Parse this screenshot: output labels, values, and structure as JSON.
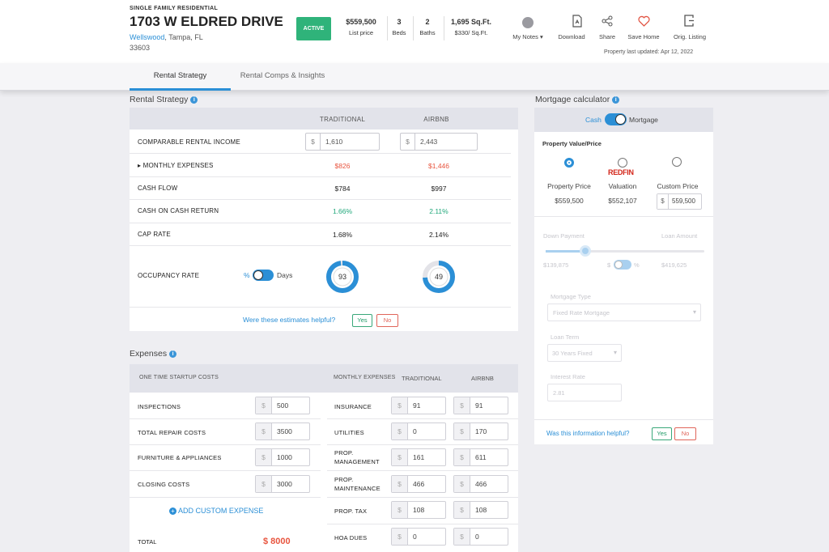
{
  "header": {
    "property_type": "SINGLE FAMILY RESIDENTIAL",
    "address": "1703 W ELDRED DRIVE",
    "neighborhood": "Wellswood",
    "city_state": ", Tampa, FL",
    "zip": "33603",
    "status": "ACTIVE",
    "list_price": "$559,500",
    "list_price_label": "List price",
    "beds": "3",
    "beds_label": "Beds",
    "baths": "2",
    "baths_label": "Baths",
    "sqft": "1,695 Sq.Ft.",
    "price_per_sqft": "$330/ Sq.Ft.",
    "actions": {
      "notes": "My Notes",
      "download": "Download",
      "share": "Share",
      "save": "Save Home",
      "listing": "Orig. Listing"
    },
    "last_updated": "Property last updated: Apr 12, 2022"
  },
  "tabs": {
    "rental_strategy": "Rental Strategy",
    "rental_comps": "Rental Comps & Insights"
  },
  "rental": {
    "title": "Rental Strategy",
    "col_traditional": "TRADITIONAL",
    "col_airbnb": "AIRBNB",
    "currency": "$",
    "rows": {
      "income": {
        "label": "COMPARABLE RENTAL INCOME",
        "trad": "1,610",
        "airbnb": "2,443"
      },
      "expenses": {
        "label": "MONTHLY EXPENSES",
        "trad": "$826",
        "airbnb": "$1,446"
      },
      "cashflow": {
        "label": "CASH FLOW",
        "trad": "$784",
        "airbnb": "$997"
      },
      "coc": {
        "label": "CASH ON CASH RETURN",
        "trad": "1.66%",
        "airbnb": "2.11%"
      },
      "cap": {
        "label": "CAP RATE",
        "trad": "1.68%",
        "airbnb": "2.14%"
      }
    },
    "occupancy": {
      "label": "OCCUPANCY RATE",
      "toggle_left": "%",
      "toggle_right": "Days",
      "trad_days": "93",
      "airbnb_days": "49",
      "trad_fraction": 0.98,
      "airbnb_fraction": 0.74
    },
    "helpful_q": "Were these estimates helpful?",
    "yes": "Yes",
    "no": "No"
  },
  "expenses": {
    "title": "Expenses",
    "startup_header": "ONE TIME STARTUP COSTS",
    "monthly_header": "MONTHLY EXPENSES",
    "col_traditional": "TRADITIONAL",
    "col_airbnb": "AIRBNB",
    "currency": "$",
    "startup": [
      {
        "label": "INSPECTIONS",
        "value": "500"
      },
      {
        "label": "TOTAL REPAIR COSTS",
        "value": "3500"
      },
      {
        "label": "FURNITURE & APPLIANCES",
        "value": "1000"
      },
      {
        "label": "CLOSING COSTS",
        "value": "3000"
      }
    ],
    "add_custom": "ADD CUSTOM EXPENSE",
    "total_label": "TOTAL",
    "total_value": "$ 8000",
    "monthly": [
      {
        "label": "INSURANCE",
        "trad": "91",
        "airbnb": "91"
      },
      {
        "label": "UTILITIES",
        "trad": "0",
        "airbnb": "170"
      },
      {
        "label": "PROP. MANAGEMENT",
        "trad": "161",
        "airbnb": "611"
      },
      {
        "label": "PROP. MAINTENANCE",
        "trad": "466",
        "airbnb": "466"
      },
      {
        "label": "PROP. TAX",
        "trad": "108",
        "airbnb": "108"
      },
      {
        "label": "HOA DUES",
        "trad": "0",
        "airbnb": "0"
      }
    ]
  },
  "mortgage": {
    "title": "Mortgage calculator",
    "cash": "Cash",
    "mortgage": "Mortgage",
    "value_title": "Property Value/Price",
    "options": [
      {
        "label": "Property Price",
        "value": "$559,500"
      },
      {
        "brand": "REDFIN",
        "label": "Valuation",
        "value": "$552,107"
      },
      {
        "label": "Custom Price",
        "value": "559,500"
      }
    ],
    "currency": "$",
    "down_payment": "Down Payment",
    "loan_amount": "Loan Amount",
    "down_value": "$139,875",
    "loan_value": "$419,625",
    "toggle_left": "$",
    "toggle_right": "%",
    "mortgage_type_label": "Mortgage Type",
    "mortgage_type": "Fixed Rate Mortgage",
    "loan_term_label": "Loan Term",
    "loan_term": "30 Years Fixed",
    "interest_label": "Interest Rate",
    "interest": "2.81",
    "helpful_q": "Was this information helpful?",
    "yes": "Yes",
    "no": "No"
  },
  "colors": {
    "accent": "#2b8fd6",
    "active_badge": "#2fb37a",
    "expense_red": "#e8553f",
    "return_green": "#1fa77a"
  }
}
